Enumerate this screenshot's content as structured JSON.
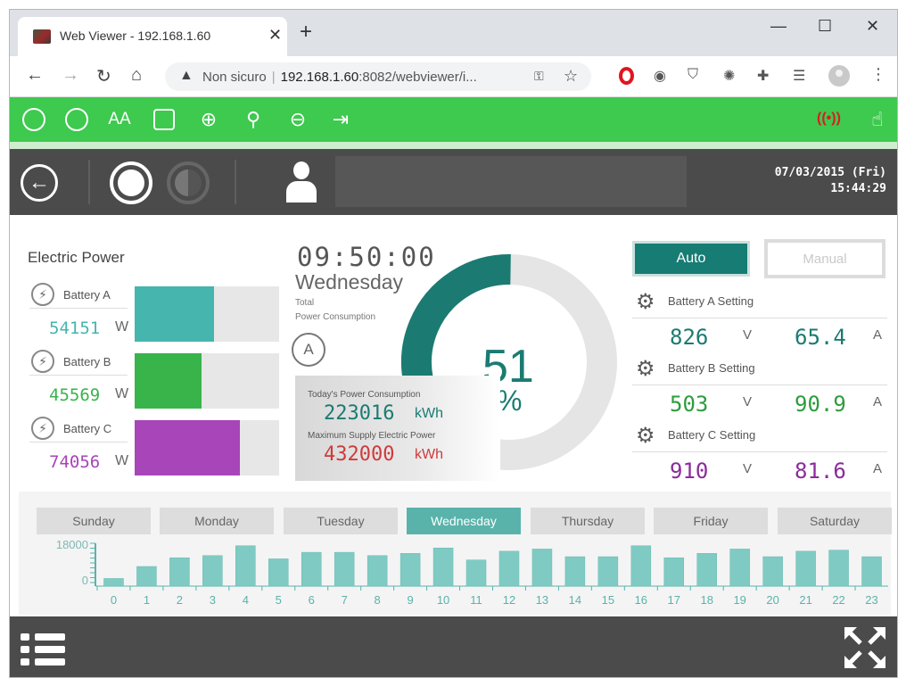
{
  "browser": {
    "tab_title": "Web Viewer - 192.168.1.60",
    "security_text": "Non sicuro",
    "url_host": "192.168.1.60",
    "url_rest": ":8082/webviewer/i..."
  },
  "header": {
    "date": "07/03/2015 (Fri)",
    "time": "15:44:29"
  },
  "electric_power": {
    "title": "Electric Power",
    "batteries": [
      {
        "name": "Battery A",
        "value": "54151",
        "unit": "W",
        "color": "#45b5ae",
        "level": 0.55
      },
      {
        "name": "Battery B",
        "value": "45569",
        "unit": "W",
        "color": "#38b44a",
        "level": 0.46
      },
      {
        "name": "Battery C",
        "value": "74056",
        "unit": "W",
        "color": "#a845b9",
        "level": 0.73
      }
    ]
  },
  "clock": {
    "time": "09:50:00",
    "weekday": "Wednesday",
    "total_line1": "Total",
    "total_line2": "Power Consumption",
    "mode_letter": "A"
  },
  "consumption": {
    "today_label": "Today's Power Consumption",
    "today_value": "223016",
    "today_unit": "kWh",
    "max_label": "Maximum Supply Electric Power",
    "max_value": "432000",
    "max_unit": "kWh"
  },
  "gauge": {
    "value": "51",
    "percent": 0.51,
    "unit": "%",
    "color": "#1b7b72"
  },
  "modes": {
    "auto_label": "Auto",
    "manual_label": "Manual"
  },
  "settings": [
    {
      "name": "Battery A Setting",
      "voltage": "826",
      "voltage_unit": "V",
      "current": "65.4",
      "current_unit": "A",
      "color": "#1b7b72"
    },
    {
      "name": "Battery B Setting",
      "voltage": "503",
      "voltage_unit": "V",
      "current": "90.9",
      "current_unit": "A",
      "color": "#2e9c3d"
    },
    {
      "name": "Battery C Setting",
      "voltage": "910",
      "voltage_unit": "V",
      "current": "81.6",
      "current_unit": "A",
      "color": "#8b2c9a"
    }
  ],
  "week": {
    "days": [
      "Sunday",
      "Monday",
      "Tuesday",
      "Wednesday",
      "Thursday",
      "Friday",
      "Saturday"
    ],
    "active": "Wednesday"
  },
  "chart_data": {
    "type": "bar",
    "title": "",
    "xlabel": "",
    "ylabel": "",
    "ylim": [
      0,
      18000
    ],
    "yticks": [
      "18000",
      "0"
    ],
    "categories": [
      "0",
      "1",
      "2",
      "3",
      "4",
      "5",
      "6",
      "7",
      "8",
      "9",
      "10",
      "11",
      "12",
      "13",
      "14",
      "15",
      "16",
      "17",
      "18",
      "19",
      "20",
      "21",
      "22",
      "23"
    ],
    "values": [
      3500,
      9000,
      13000,
      14000,
      18500,
      12500,
      15500,
      15500,
      14000,
      15000,
      17500,
      12000,
      16000,
      17000,
      13500,
      13500,
      18500,
      13000,
      15000,
      17000,
      13500,
      16000,
      16500,
      13500
    ],
    "color": "#7fcbc3"
  }
}
